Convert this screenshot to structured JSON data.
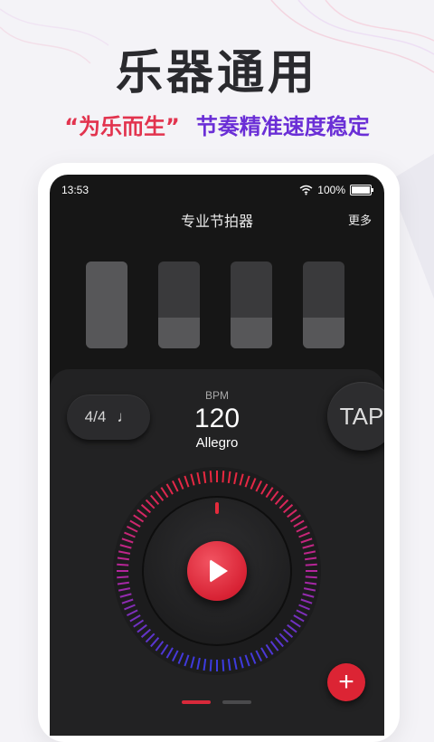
{
  "promo": {
    "headline": "乐器通用",
    "sub_quote": "“为乐而生”",
    "sub_rest": "节奏精准速度稳定"
  },
  "status_bar": {
    "time": "13:53",
    "battery": "100%"
  },
  "app": {
    "title": "专业节拍器",
    "more_label": "更多"
  },
  "beats": [
    {
      "level": 1.0
    },
    {
      "level": 0.35
    },
    {
      "level": 0.35
    },
    {
      "level": 0.35
    }
  ],
  "controls": {
    "time_signature": "4/4",
    "note_icon": "quarter-note-icon",
    "note_glyph": "♩",
    "bpm_label": "BPM",
    "bpm_value": "120",
    "tempo_name": "Allegro",
    "tap_label": "TAP",
    "play_icon": "play-icon",
    "add_icon": "plus-icon",
    "add_glyph": "+"
  },
  "pager": {
    "pages": 2,
    "active": 0
  },
  "colors": {
    "accent_red": "#d82234",
    "accent_purple": "#6a2ed6",
    "screen_bg": "#161616"
  }
}
